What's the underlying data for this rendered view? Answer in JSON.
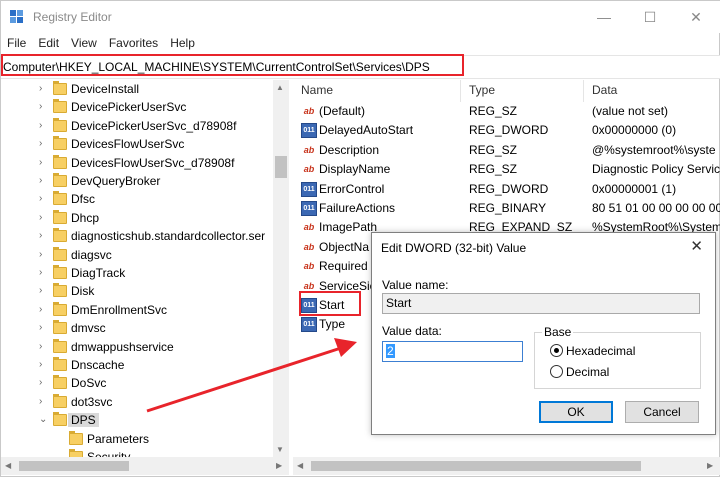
{
  "window": {
    "title": "Registry Editor",
    "buttons": {
      "minimize": "—",
      "maximize": "☐",
      "close": "✕"
    }
  },
  "menu": [
    "File",
    "Edit",
    "View",
    "Favorites",
    "Help"
  ],
  "address": {
    "path": "Computer\\HKEY_LOCAL_MACHINE\\SYSTEM\\CurrentControlSet\\Services\\DPS"
  },
  "tree": {
    "items": [
      {
        "label": "DeviceInstall",
        "expander": "›"
      },
      {
        "label": "DevicePickerUserSvc",
        "expander": "›"
      },
      {
        "label": "DevicePickerUserSvc_d78908f",
        "expander": "›"
      },
      {
        "label": "DevicesFlowUserSvc",
        "expander": "›"
      },
      {
        "label": "DevicesFlowUserSvc_d78908f",
        "expander": "›"
      },
      {
        "label": "DevQueryBroker",
        "expander": "›"
      },
      {
        "label": "Dfsc",
        "expander": "›"
      },
      {
        "label": "Dhcp",
        "expander": "›"
      },
      {
        "label": "diagnosticshub.standardcollector.ser",
        "expander": "›"
      },
      {
        "label": "diagsvc",
        "expander": "›"
      },
      {
        "label": "DiagTrack",
        "expander": "›"
      },
      {
        "label": "Disk",
        "expander": "›"
      },
      {
        "label": "DmEnrollmentSvc",
        "expander": "›"
      },
      {
        "label": "dmvsc",
        "expander": "›"
      },
      {
        "label": "dmwappushservice",
        "expander": "›"
      },
      {
        "label": "Dnscache",
        "expander": "›"
      },
      {
        "label": "DoSvc",
        "expander": "›"
      },
      {
        "label": "dot3svc",
        "expander": "›"
      },
      {
        "label": "DPS",
        "expander": "⌄"
      }
    ],
    "children": [
      {
        "label": "Parameters"
      },
      {
        "label": "Security"
      }
    ]
  },
  "list": {
    "columns": [
      "Name",
      "Type",
      "Data"
    ],
    "rows": [
      {
        "icon": "string-value-icon",
        "name": "(Default)",
        "type": "REG_SZ",
        "data": "(value not set)"
      },
      {
        "icon": "binary-value-icon",
        "name": "DelayedAutoStart",
        "type": "REG_DWORD",
        "data": "0x00000000 (0)"
      },
      {
        "icon": "string-value-icon",
        "name": "Description",
        "type": "REG_SZ",
        "data": "@%systemroot%\\syste"
      },
      {
        "icon": "string-value-icon",
        "name": "DisplayName",
        "type": "REG_SZ",
        "data": "Diagnostic Policy Servic"
      },
      {
        "icon": "binary-value-icon",
        "name": "ErrorControl",
        "type": "REG_DWORD",
        "data": "0x00000001 (1)"
      },
      {
        "icon": "binary-value-icon",
        "name": "FailureActions",
        "type": "REG_BINARY",
        "data": "80 51 01 00 00 00 00 00"
      },
      {
        "icon": "string-value-icon",
        "name": "ImagePath",
        "type": "REG_EXPAND_SZ",
        "data": "%SystemRoot%\\System"
      },
      {
        "icon": "string-value-icon",
        "name": "ObjectNa",
        "type": "",
        "data": ""
      },
      {
        "icon": "string-value-icon",
        "name": "Required",
        "type": "",
        "data": ""
      },
      {
        "icon": "string-value-icon",
        "name": "ServiceSic",
        "type": "",
        "data": ""
      },
      {
        "icon": "binary-value-icon",
        "name": "Start",
        "type": "",
        "data": ""
      },
      {
        "icon": "binary-value-icon",
        "name": "Type",
        "type": "",
        "data": ""
      }
    ],
    "icon_glyphs": {
      "string": "ab",
      "binary": "011"
    }
  },
  "dialog": {
    "title": "Edit DWORD (32-bit) Value",
    "close": "✕",
    "value_name_label": "Value name:",
    "value_name": "Start",
    "value_data_label": "Value data:",
    "value_data": "2",
    "base_label": "Base",
    "base_options": [
      "Hexadecimal",
      "Decimal"
    ],
    "base_selected": "Hexadecimal",
    "ok": "OK",
    "cancel": "Cancel"
  },
  "annotation": {
    "highlight_color": "#e8242b",
    "arrow_color": "#e8242b"
  }
}
